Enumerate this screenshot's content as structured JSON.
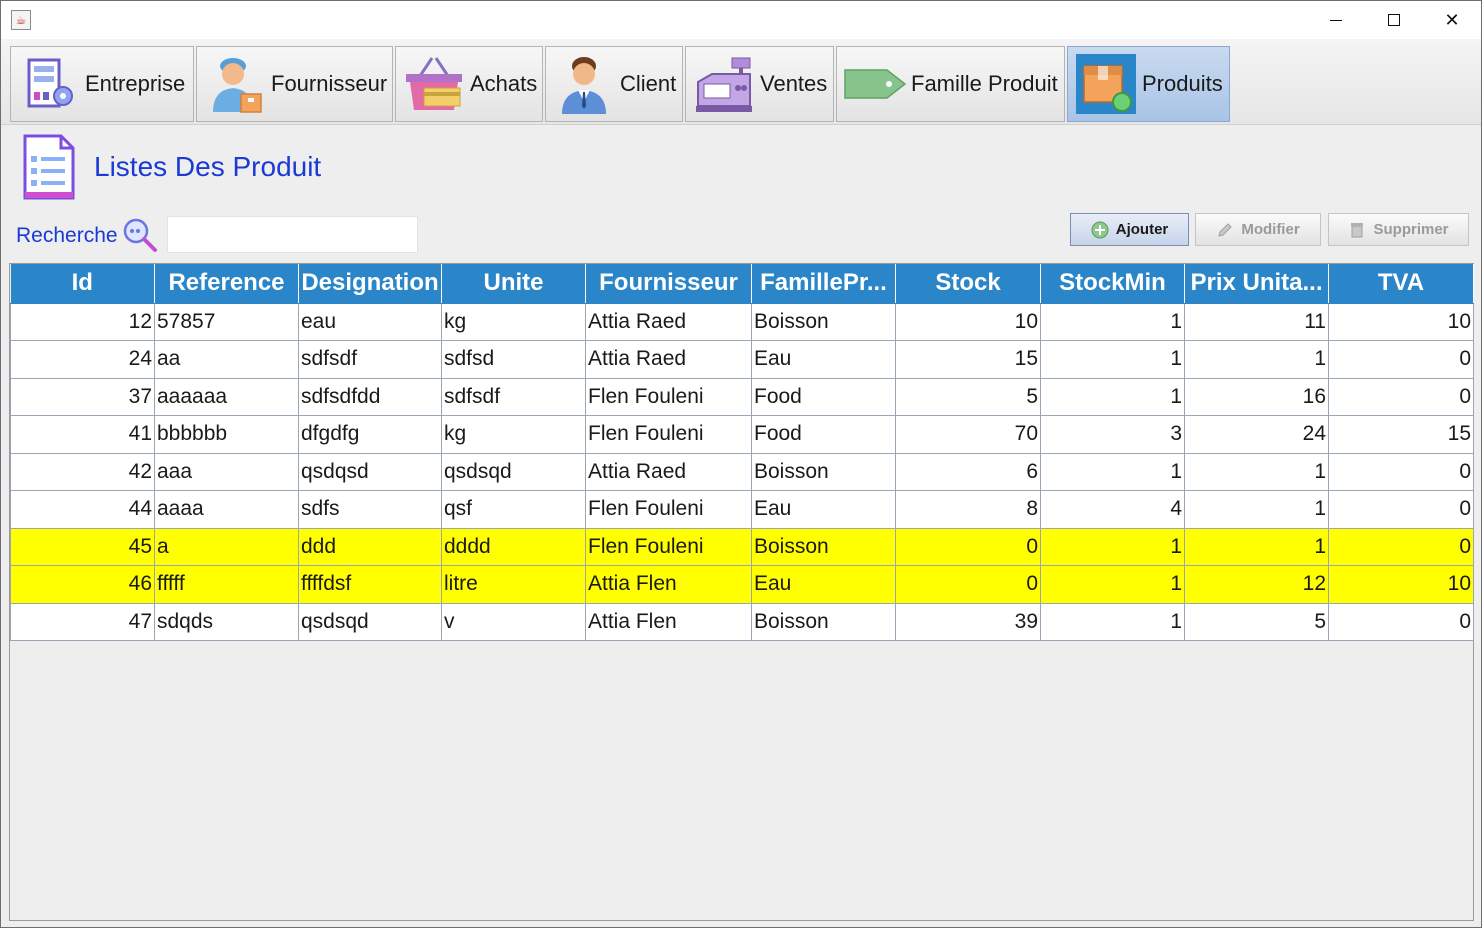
{
  "window": {
    "controls": {
      "minimize": "minimize-icon",
      "maximize": "maximize-icon",
      "close": "close-icon"
    }
  },
  "toolbar": {
    "tabs": [
      {
        "label": "Entreprise",
        "icon": "building-icon"
      },
      {
        "label": "Fournisseur",
        "icon": "delivery-man-icon"
      },
      {
        "label": "Achats",
        "icon": "basket-icon"
      },
      {
        "label": "Client",
        "icon": "person-icon"
      },
      {
        "label": "Ventes",
        "icon": "cash-register-icon"
      },
      {
        "label": "Famille Produit",
        "icon": "tag-icon"
      },
      {
        "label": "Produits",
        "icon": "box-icon",
        "active": true
      }
    ]
  },
  "page": {
    "title": "Listes Des Produit"
  },
  "search": {
    "label": "Recherche",
    "value": ""
  },
  "actions": {
    "add_label": "Ajouter",
    "edit_label": "Modifier",
    "delete_label": "Supprimer"
  },
  "table": {
    "columns": [
      "Id",
      "Reference",
      "Designation",
      "Unite",
      "Fournisseur",
      "FamillePr...",
      "Stock",
      "StockMin",
      "Prix Unita...",
      "TVA"
    ],
    "rows": [
      {
        "id": "12",
        "reference": "57857",
        "designation": "eau",
        "unite": "kg",
        "fournisseur": "Attia Raed",
        "famille": "Boisson",
        "stock": "10",
        "stockmin": "1",
        "prix": "11",
        "tva": "10",
        "alert": false
      },
      {
        "id": "24",
        "reference": "aa",
        "designation": "sdfsdf",
        "unite": "sdfsd",
        "fournisseur": "Attia Raed",
        "famille": "Eau",
        "stock": "15",
        "stockmin": "1",
        "prix": "1",
        "tva": "0",
        "alert": false
      },
      {
        "id": "37",
        "reference": "aaaaaa",
        "designation": "sdfsdfdd",
        "unite": "sdfsdf",
        "fournisseur": "Flen Fouleni",
        "famille": "Food",
        "stock": "5",
        "stockmin": "1",
        "prix": "16",
        "tva": "0",
        "alert": false
      },
      {
        "id": "41",
        "reference": "bbbbbb",
        "designation": "dfgdfg",
        "unite": "kg",
        "fournisseur": "Flen Fouleni",
        "famille": "Food",
        "stock": "70",
        "stockmin": "3",
        "prix": "24",
        "tva": "15",
        "alert": false
      },
      {
        "id": "42",
        "reference": "aaa",
        "designation": "qsdqsd",
        "unite": "qsdsqd",
        "fournisseur": "Attia Raed",
        "famille": "Boisson",
        "stock": "6",
        "stockmin": "1",
        "prix": "1",
        "tva": "0",
        "alert": false
      },
      {
        "id": "44",
        "reference": "aaaa",
        "designation": "sdfs",
        "unite": "qsf",
        "fournisseur": "Flen Fouleni",
        "famille": "Eau",
        "stock": "8",
        "stockmin": "4",
        "prix": "1",
        "tva": "0",
        "alert": false
      },
      {
        "id": "45",
        "reference": "a",
        "designation": "ddd",
        "unite": "dddd",
        "fournisseur": "Flen Fouleni",
        "famille": "Boisson",
        "stock": "0",
        "stockmin": "1",
        "prix": "1",
        "tva": "0",
        "alert": true
      },
      {
        "id": "46",
        "reference": "fffff",
        "designation": "ffffdsf",
        "unite": "litre",
        "fournisseur": "Attia Flen",
        "famille": "Eau",
        "stock": "0",
        "stockmin": "1",
        "prix": "12",
        "tva": "10",
        "alert": true
      },
      {
        "id": "47",
        "reference": "sdqds",
        "designation": "qsdsqd",
        "unite": "v",
        "fournisseur": "Attia Flen",
        "famille": "Boisson",
        "stock": "39",
        "stockmin": "1",
        "prix": "5",
        "tva": "0",
        "alert": false
      }
    ]
  },
  "colors": {
    "header_bg": "#2a86c8",
    "alert_row": "#ffff00",
    "title_blue": "#1a3ad6",
    "active_tab": "#b7cfee"
  }
}
